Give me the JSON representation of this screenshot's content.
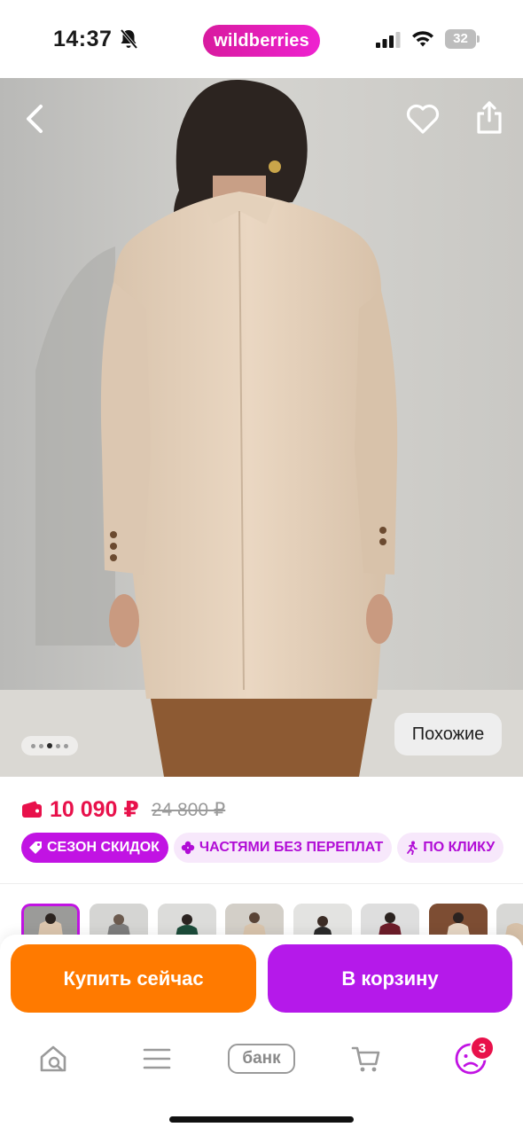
{
  "status_bar": {
    "time": "14:37",
    "battery": "32",
    "brand": "wildberries"
  },
  "product": {
    "price_current": "10 090 ₽",
    "price_old": "24 800 ₽",
    "similar_label": "Похожие",
    "gallery_dots": 5,
    "gallery_active_index": 2
  },
  "tags": [
    {
      "label": "СЕЗОН СКИДОК",
      "icon": "tag-icon"
    },
    {
      "label": "ЧАСТЯМИ БЕЗ ПЕРЕПЛАТ",
      "icon": "clover-icon"
    },
    {
      "label": "ПО КЛИКУ",
      "icon": "running-person-icon"
    }
  ],
  "actions": {
    "buy_now": "Купить сейчас",
    "add_to_cart": "В корзину"
  },
  "bottom_nav": {
    "home_icon": "home-search-icon",
    "menu_icon": "menu-icon",
    "bank_label": "банк",
    "cart_icon": "cart-icon",
    "profile_icon": "profile-icon",
    "profile_badge": "3"
  },
  "colors": {
    "brand": "#cb11ab",
    "price": "#e8114b",
    "buy": "#ff7a00",
    "cart": "#b519ea"
  }
}
